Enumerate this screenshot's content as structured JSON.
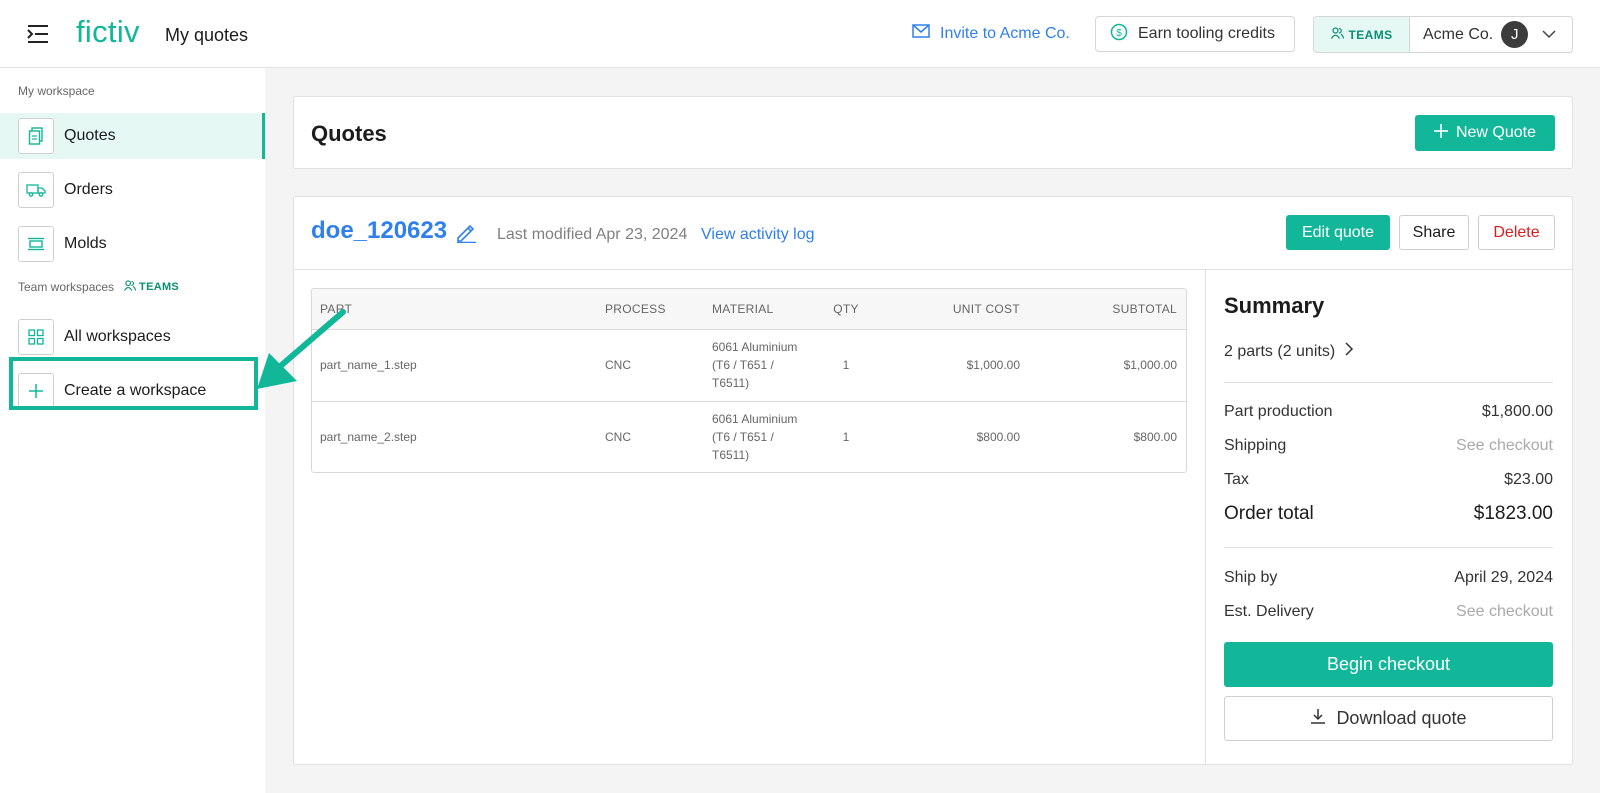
{
  "topbar": {
    "logo": "fictiv",
    "page_heading": "My quotes",
    "invite_label": "Invite to Acme Co.",
    "earn_label": "Earn tooling credits",
    "teams_tag": "TEAMS",
    "org_name": "Acme Co.",
    "avatar_initial": "J"
  },
  "sidebar": {
    "my_workspace_label": "My workspace",
    "items": [
      {
        "label": "Quotes",
        "icon": "document-icon"
      },
      {
        "label": "Orders",
        "icon": "truck-icon"
      },
      {
        "label": "Molds",
        "icon": "mold-icon"
      }
    ],
    "team_workspaces_label": "Team workspaces",
    "teams_tag": "TEAMS",
    "team_items": [
      {
        "label": "All workspaces",
        "icon": "grid-icon"
      },
      {
        "label": "Create a workspace",
        "icon": "plus-icon"
      }
    ]
  },
  "quotes_header": {
    "title": "Quotes",
    "new_quote_label": "New Quote"
  },
  "quote": {
    "name": "doe_120623",
    "last_modified": "Last modified Apr 23, 2024",
    "activity_link": "View activity log",
    "edit_label": "Edit quote",
    "share_label": "Share",
    "delete_label": "Delete"
  },
  "table": {
    "headers": {
      "part": "PART",
      "process": "PROCESS",
      "material": "MATERIAL",
      "qty": "QTY",
      "unit_cost": "UNIT COST",
      "subtotal": "SUBTOTAL"
    },
    "rows": [
      {
        "part": "part_name_1.step",
        "process": "CNC",
        "material": "6061 Aluminium (T6 / T651 / T6511)",
        "qty": "1",
        "unit_cost": "$1,000.00",
        "subtotal": "$1,000.00"
      },
      {
        "part": "part_name_2.step",
        "process": "CNC",
        "material": "6061 Aluminium (T6 / T651 / T6511)",
        "qty": "1",
        "unit_cost": "$800.00",
        "subtotal": "$800.00"
      }
    ]
  },
  "summary": {
    "title": "Summary",
    "parts_link": "2 parts (2 units)",
    "part_production_label": "Part production",
    "part_production_value": "$1,800.00",
    "shipping_label": "Shipping",
    "shipping_value": "See checkout",
    "tax_label": "Tax",
    "tax_value": "$23.00",
    "total_label": "Order total",
    "total_value": "$1823.00",
    "ship_by_label": "Ship by",
    "ship_by_value": "April 29, 2024",
    "delivery_label": "Est. Delivery",
    "delivery_value": "See checkout",
    "checkout_label": "Begin checkout",
    "download_label": "Download quote"
  },
  "colors": {
    "accent": "#12b79a",
    "link": "#2f80ed",
    "danger": "#d81f1f"
  }
}
